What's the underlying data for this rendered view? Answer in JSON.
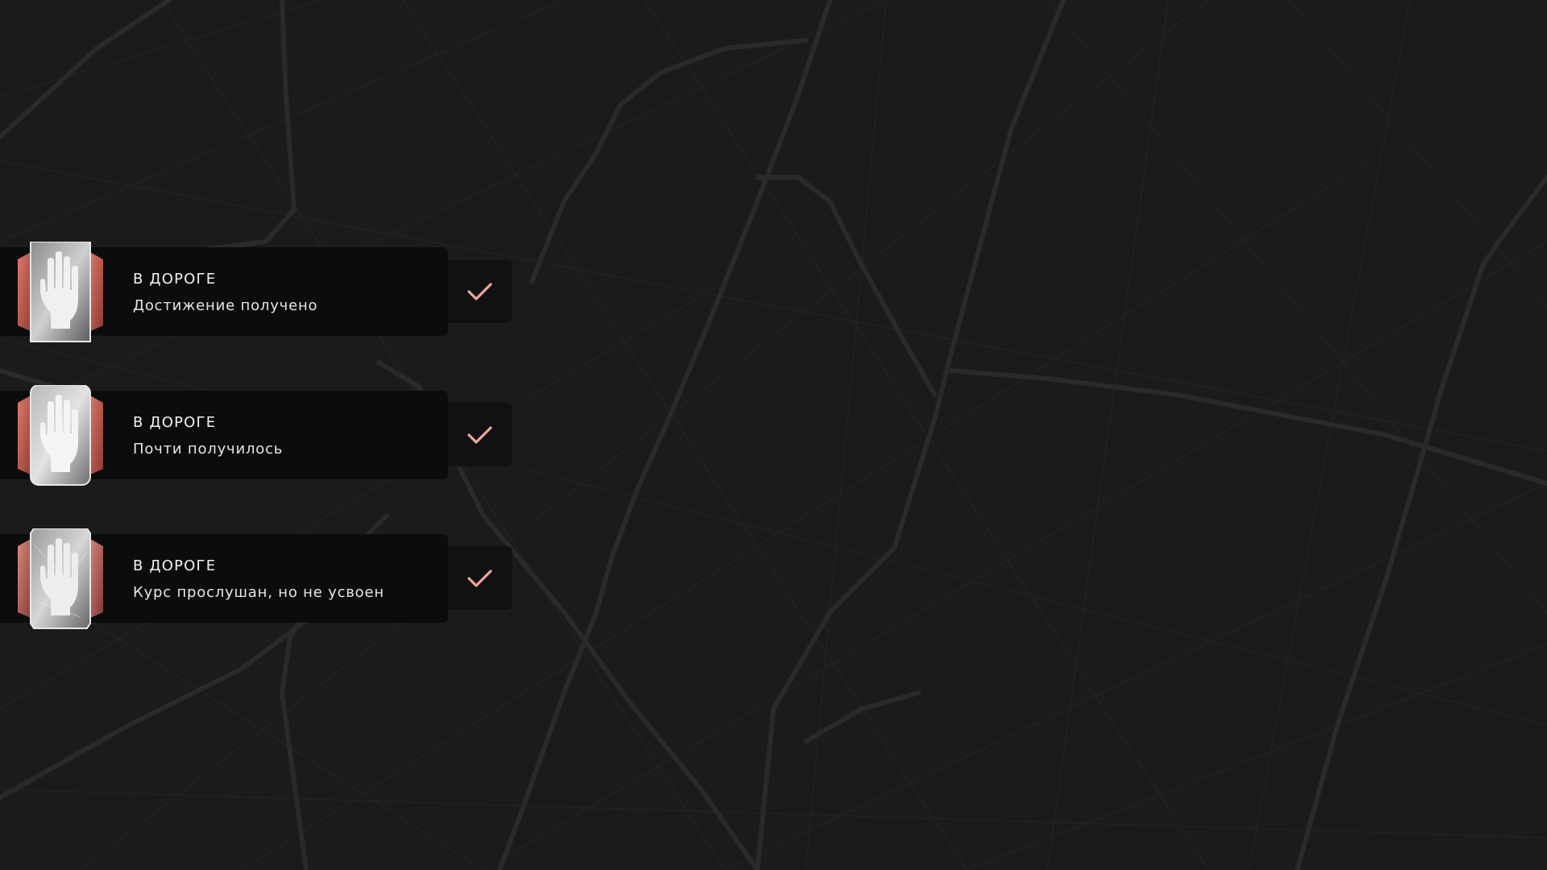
{
  "colors": {
    "background": "#1b1b1d",
    "road": "#2a2a2d",
    "panel": "#0c0c0d",
    "check_panel": "#111112",
    "check": "#e8a79a",
    "badge_accent": "#c96a5e",
    "text": "#f2f2f2"
  },
  "notifications": [
    {
      "title": "В ДОРОГЕ",
      "description": "Достижение получено",
      "icon": "raised-hand-icon",
      "status_icon": "checkmark-icon"
    },
    {
      "title": "В ДОРОГЕ",
      "description": "Почти получилось",
      "icon": "raised-hand-icon",
      "status_icon": "checkmark-icon"
    },
    {
      "title": "В ДОРОГЕ",
      "description": "Курс прослушан, но не усвоен",
      "icon": "raised-hand-icon",
      "status_icon": "checkmark-icon"
    }
  ]
}
